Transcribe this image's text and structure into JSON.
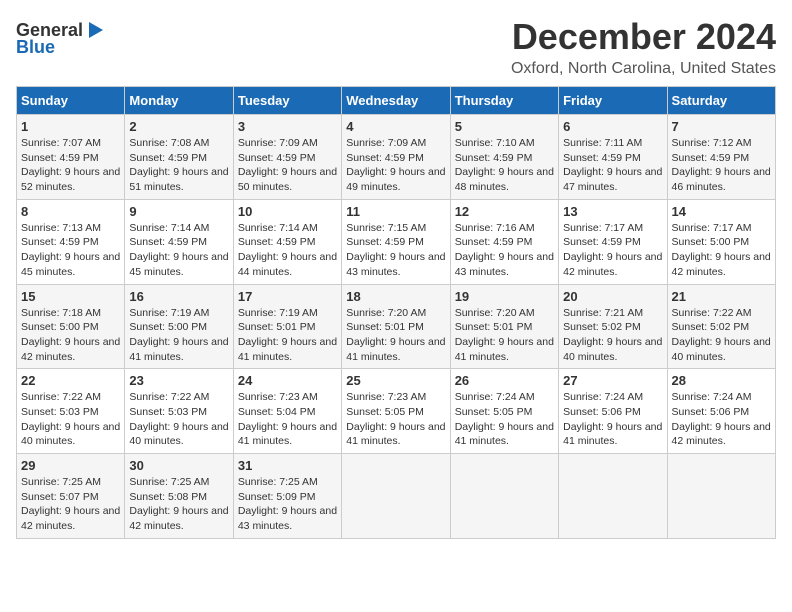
{
  "header": {
    "logo_general": "General",
    "logo_blue": "Blue",
    "title": "December 2024",
    "subtitle": "Oxford, North Carolina, United States"
  },
  "days_of_week": [
    "Sunday",
    "Monday",
    "Tuesday",
    "Wednesday",
    "Thursday",
    "Friday",
    "Saturday"
  ],
  "weeks": [
    [
      {
        "day": "1",
        "sunrise": "Sunrise: 7:07 AM",
        "sunset": "Sunset: 4:59 PM",
        "daylight": "Daylight: 9 hours and 52 minutes."
      },
      {
        "day": "2",
        "sunrise": "Sunrise: 7:08 AM",
        "sunset": "Sunset: 4:59 PM",
        "daylight": "Daylight: 9 hours and 51 minutes."
      },
      {
        "day": "3",
        "sunrise": "Sunrise: 7:09 AM",
        "sunset": "Sunset: 4:59 PM",
        "daylight": "Daylight: 9 hours and 50 minutes."
      },
      {
        "day": "4",
        "sunrise": "Sunrise: 7:09 AM",
        "sunset": "Sunset: 4:59 PM",
        "daylight": "Daylight: 9 hours and 49 minutes."
      },
      {
        "day": "5",
        "sunrise": "Sunrise: 7:10 AM",
        "sunset": "Sunset: 4:59 PM",
        "daylight": "Daylight: 9 hours and 48 minutes."
      },
      {
        "day": "6",
        "sunrise": "Sunrise: 7:11 AM",
        "sunset": "Sunset: 4:59 PM",
        "daylight": "Daylight: 9 hours and 47 minutes."
      },
      {
        "day": "7",
        "sunrise": "Sunrise: 7:12 AM",
        "sunset": "Sunset: 4:59 PM",
        "daylight": "Daylight: 9 hours and 46 minutes."
      }
    ],
    [
      {
        "day": "8",
        "sunrise": "Sunrise: 7:13 AM",
        "sunset": "Sunset: 4:59 PM",
        "daylight": "Daylight: 9 hours and 45 minutes."
      },
      {
        "day": "9",
        "sunrise": "Sunrise: 7:14 AM",
        "sunset": "Sunset: 4:59 PM",
        "daylight": "Daylight: 9 hours and 45 minutes."
      },
      {
        "day": "10",
        "sunrise": "Sunrise: 7:14 AM",
        "sunset": "Sunset: 4:59 PM",
        "daylight": "Daylight: 9 hours and 44 minutes."
      },
      {
        "day": "11",
        "sunrise": "Sunrise: 7:15 AM",
        "sunset": "Sunset: 4:59 PM",
        "daylight": "Daylight: 9 hours and 43 minutes."
      },
      {
        "day": "12",
        "sunrise": "Sunrise: 7:16 AM",
        "sunset": "Sunset: 4:59 PM",
        "daylight": "Daylight: 9 hours and 43 minutes."
      },
      {
        "day": "13",
        "sunrise": "Sunrise: 7:17 AM",
        "sunset": "Sunset: 4:59 PM",
        "daylight": "Daylight: 9 hours and 42 minutes."
      },
      {
        "day": "14",
        "sunrise": "Sunrise: 7:17 AM",
        "sunset": "Sunset: 5:00 PM",
        "daylight": "Daylight: 9 hours and 42 minutes."
      }
    ],
    [
      {
        "day": "15",
        "sunrise": "Sunrise: 7:18 AM",
        "sunset": "Sunset: 5:00 PM",
        "daylight": "Daylight: 9 hours and 42 minutes."
      },
      {
        "day": "16",
        "sunrise": "Sunrise: 7:19 AM",
        "sunset": "Sunset: 5:00 PM",
        "daylight": "Daylight: 9 hours and 41 minutes."
      },
      {
        "day": "17",
        "sunrise": "Sunrise: 7:19 AM",
        "sunset": "Sunset: 5:01 PM",
        "daylight": "Daylight: 9 hours and 41 minutes."
      },
      {
        "day": "18",
        "sunrise": "Sunrise: 7:20 AM",
        "sunset": "Sunset: 5:01 PM",
        "daylight": "Daylight: 9 hours and 41 minutes."
      },
      {
        "day": "19",
        "sunrise": "Sunrise: 7:20 AM",
        "sunset": "Sunset: 5:01 PM",
        "daylight": "Daylight: 9 hours and 41 minutes."
      },
      {
        "day": "20",
        "sunrise": "Sunrise: 7:21 AM",
        "sunset": "Sunset: 5:02 PM",
        "daylight": "Daylight: 9 hours and 40 minutes."
      },
      {
        "day": "21",
        "sunrise": "Sunrise: 7:22 AM",
        "sunset": "Sunset: 5:02 PM",
        "daylight": "Daylight: 9 hours and 40 minutes."
      }
    ],
    [
      {
        "day": "22",
        "sunrise": "Sunrise: 7:22 AM",
        "sunset": "Sunset: 5:03 PM",
        "daylight": "Daylight: 9 hours and 40 minutes."
      },
      {
        "day": "23",
        "sunrise": "Sunrise: 7:22 AM",
        "sunset": "Sunset: 5:03 PM",
        "daylight": "Daylight: 9 hours and 40 minutes."
      },
      {
        "day": "24",
        "sunrise": "Sunrise: 7:23 AM",
        "sunset": "Sunset: 5:04 PM",
        "daylight": "Daylight: 9 hours and 41 minutes."
      },
      {
        "day": "25",
        "sunrise": "Sunrise: 7:23 AM",
        "sunset": "Sunset: 5:05 PM",
        "daylight": "Daylight: 9 hours and 41 minutes."
      },
      {
        "day": "26",
        "sunrise": "Sunrise: 7:24 AM",
        "sunset": "Sunset: 5:05 PM",
        "daylight": "Daylight: 9 hours and 41 minutes."
      },
      {
        "day": "27",
        "sunrise": "Sunrise: 7:24 AM",
        "sunset": "Sunset: 5:06 PM",
        "daylight": "Daylight: 9 hours and 41 minutes."
      },
      {
        "day": "28",
        "sunrise": "Sunrise: 7:24 AM",
        "sunset": "Sunset: 5:06 PM",
        "daylight": "Daylight: 9 hours and 42 minutes."
      }
    ],
    [
      {
        "day": "29",
        "sunrise": "Sunrise: 7:25 AM",
        "sunset": "Sunset: 5:07 PM",
        "daylight": "Daylight: 9 hours and 42 minutes."
      },
      {
        "day": "30",
        "sunrise": "Sunrise: 7:25 AM",
        "sunset": "Sunset: 5:08 PM",
        "daylight": "Daylight: 9 hours and 42 minutes."
      },
      {
        "day": "31",
        "sunrise": "Sunrise: 7:25 AM",
        "sunset": "Sunset: 5:09 PM",
        "daylight": "Daylight: 9 hours and 43 minutes."
      },
      null,
      null,
      null,
      null
    ]
  ]
}
